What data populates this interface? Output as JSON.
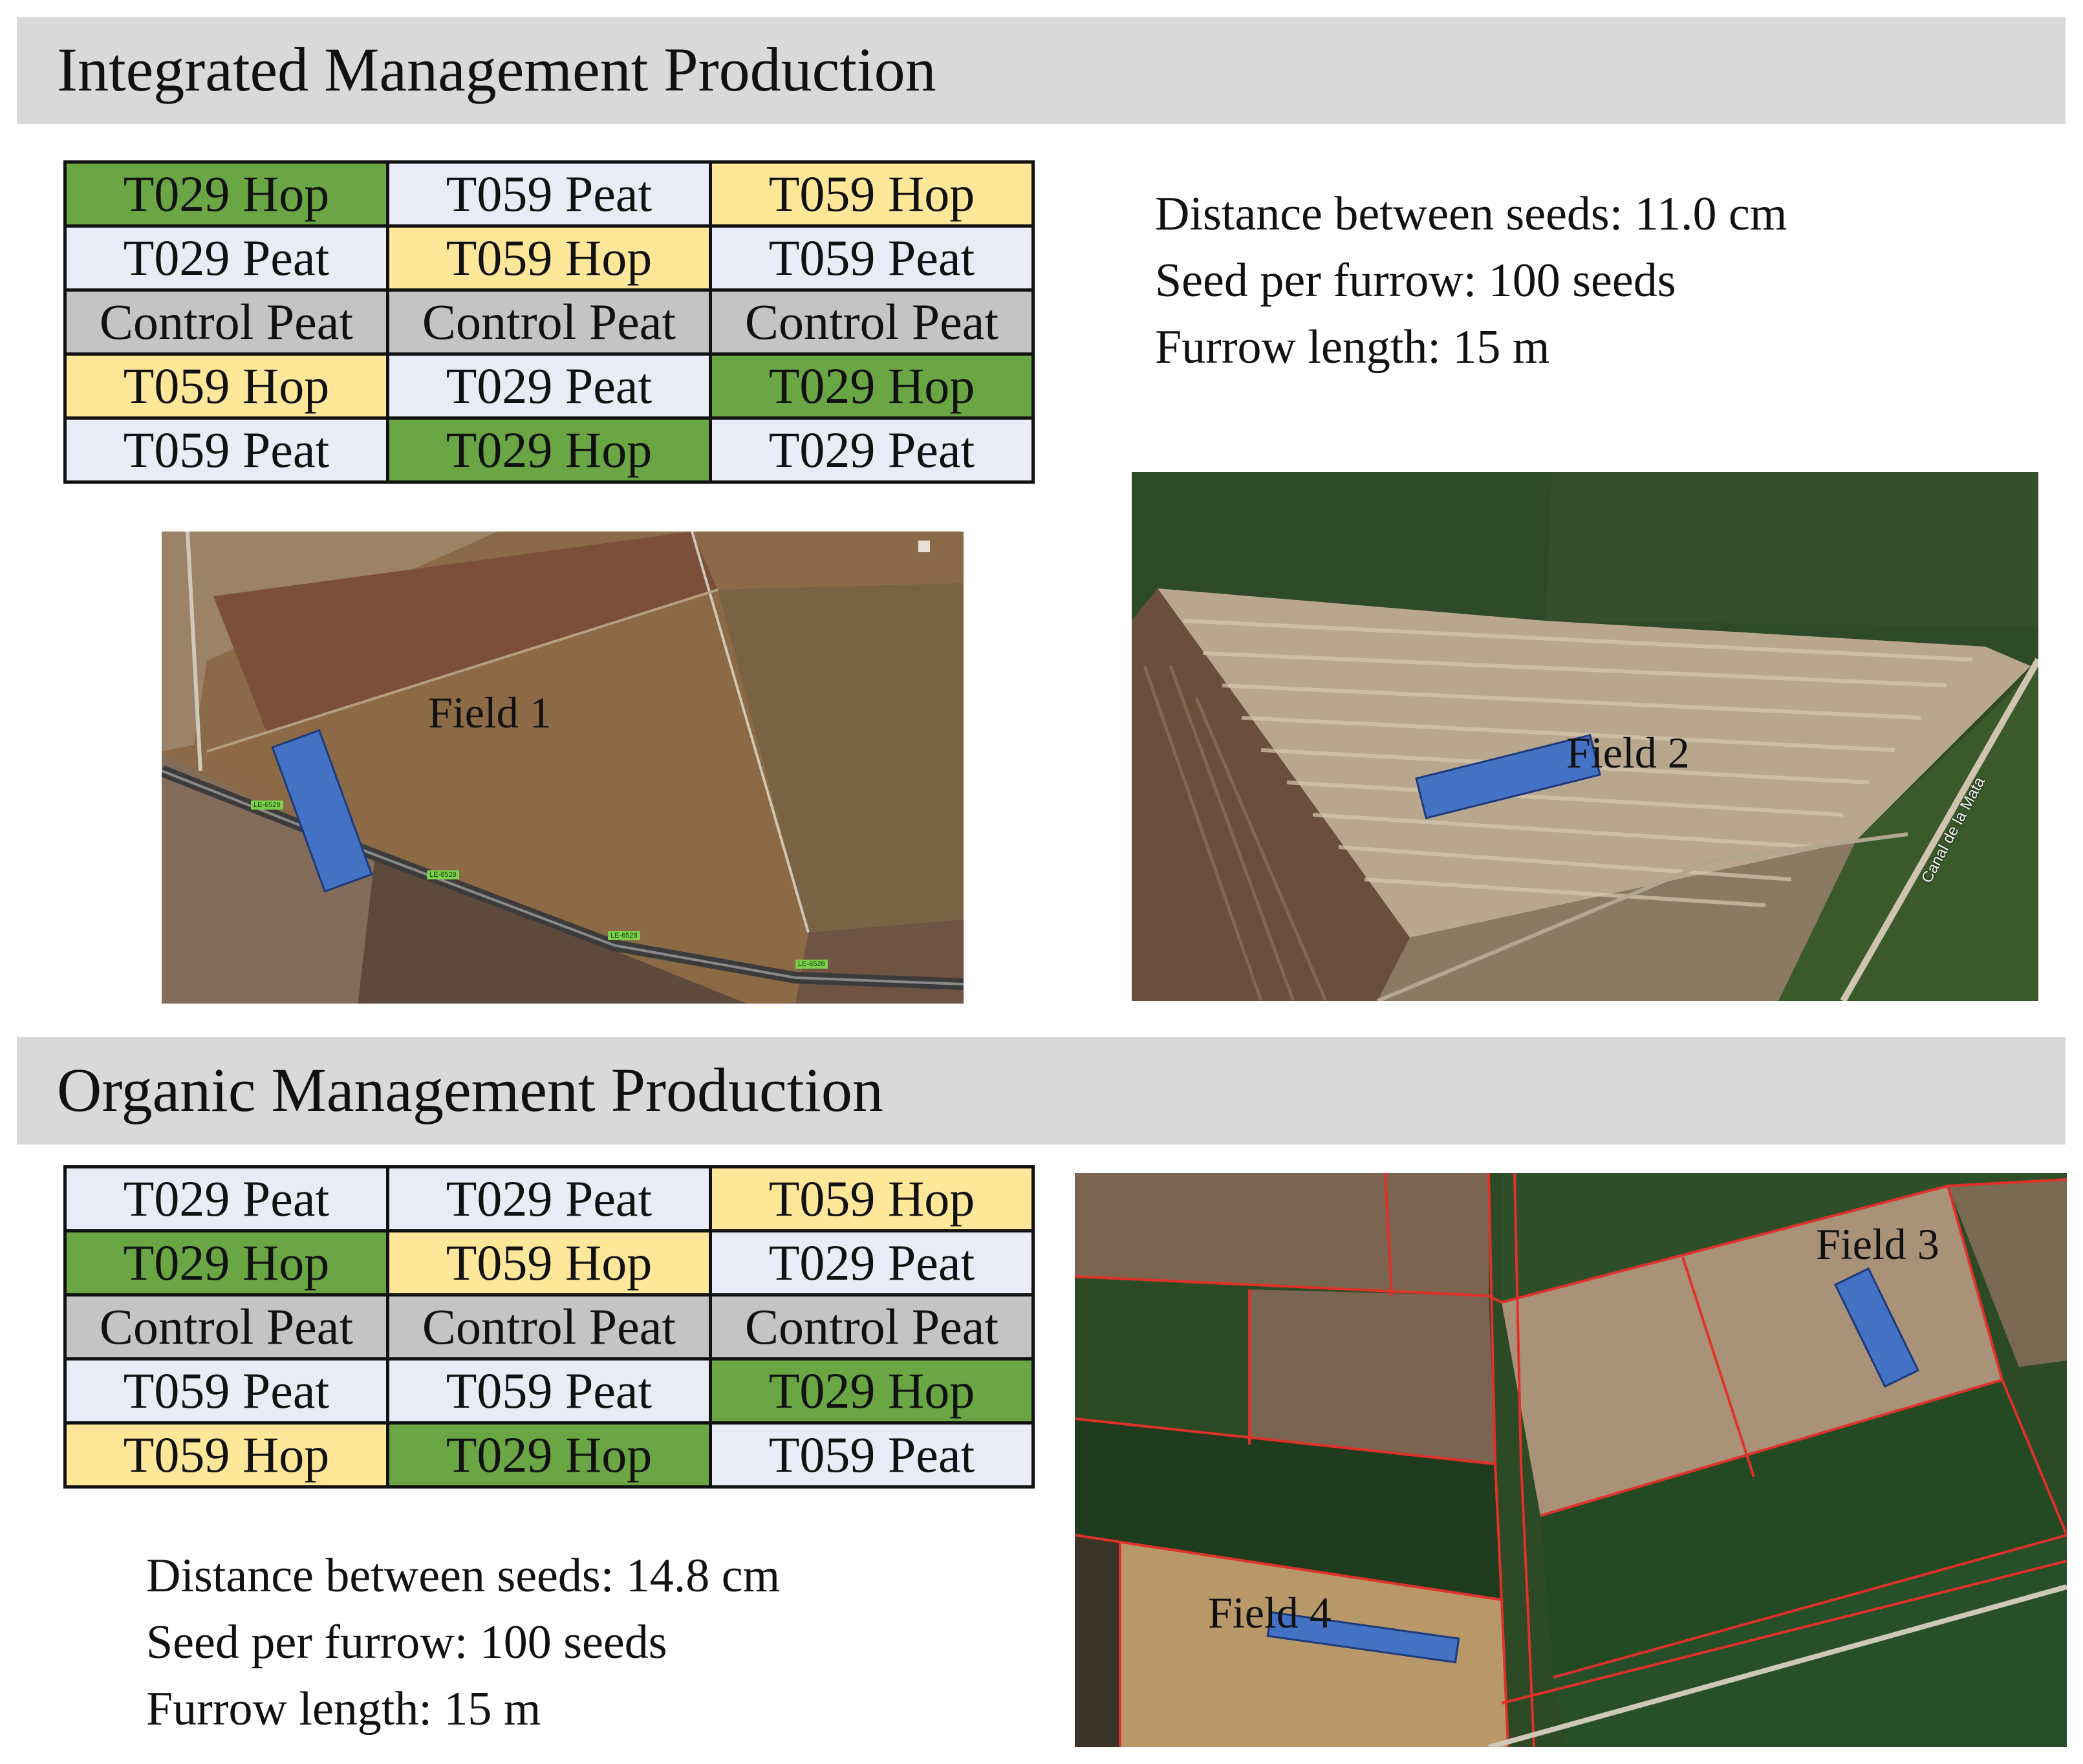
{
  "sections": [
    {
      "title": "Integrated Management Production",
      "grid": [
        [
          {
            "label": "T029 Hop",
            "kind": "hop29"
          },
          {
            "label": "T059 Peat",
            "kind": "peat"
          },
          {
            "label": "T059 Hop",
            "kind": "hop59"
          }
        ],
        [
          {
            "label": "T029 Peat",
            "kind": "peat"
          },
          {
            "label": "T059 Hop",
            "kind": "hop59"
          },
          {
            "label": "T059 Peat",
            "kind": "peat"
          }
        ],
        [
          {
            "label": "Control Peat",
            "kind": "ctrl"
          },
          {
            "label": "Control Peat",
            "kind": "ctrl"
          },
          {
            "label": "Control Peat",
            "kind": "ctrl"
          }
        ],
        [
          {
            "label": "T059 Hop",
            "kind": "hop59"
          },
          {
            "label": "T029 Peat",
            "kind": "peat"
          },
          {
            "label": "T029 Hop",
            "kind": "hop29"
          }
        ],
        [
          {
            "label": "T059 Peat",
            "kind": "peat"
          },
          {
            "label": "T029 Hop",
            "kind": "hop29"
          },
          {
            "label": "T029 Peat",
            "kind": "peat"
          }
        ]
      ],
      "info": [
        "Distance between seeds: 11.0 cm",
        "Seed per furrow: 100 seeds",
        "Furrow length: 15 m"
      ],
      "fields": [
        {
          "label": "Field 1",
          "map_labels": [
            "LE-6528",
            "LE-6528",
            "LE-6528",
            "LE-6528"
          ]
        },
        {
          "label": "Field 2",
          "map_labels": [
            "Canal de la Mata"
          ]
        }
      ]
    },
    {
      "title": "Organic Management Production",
      "grid": [
        [
          {
            "label": "T029 Peat",
            "kind": "peat"
          },
          {
            "label": "T029 Peat",
            "kind": "peat"
          },
          {
            "label": "T059 Hop",
            "kind": "hop59"
          }
        ],
        [
          {
            "label": "T029 Hop",
            "kind": "hop29"
          },
          {
            "label": "T059 Hop",
            "kind": "hop59"
          },
          {
            "label": "T029 Peat",
            "kind": "peat"
          }
        ],
        [
          {
            "label": "Control Peat",
            "kind": "ctrl"
          },
          {
            "label": "Control Peat",
            "kind": "ctrl"
          },
          {
            "label": "Control Peat",
            "kind": "ctrl"
          }
        ],
        [
          {
            "label": "T059 Peat",
            "kind": "peat"
          },
          {
            "label": "T059 Peat",
            "kind": "peat"
          },
          {
            "label": "T029 Hop",
            "kind": "hop29"
          }
        ],
        [
          {
            "label": "T059 Hop",
            "kind": "hop59"
          },
          {
            "label": "T029 Hop",
            "kind": "hop29"
          },
          {
            "label": "T059 Peat",
            "kind": "peat"
          }
        ]
      ],
      "info": [
        "Distance between seeds: 14.8 cm",
        "Seed per furrow: 100 seeds",
        "Furrow length: 15 m"
      ],
      "fields": [
        {
          "label": "Field 3"
        },
        {
          "label": "Field 4"
        }
      ]
    }
  ],
  "colors": {
    "hop29": "#6aa644",
    "hop59": "#ffe79a",
    "peat": "#e9ecf6",
    "ctrl": "#c4c4c4",
    "banner": "#d9d9d9",
    "plot": "#4472c4"
  }
}
